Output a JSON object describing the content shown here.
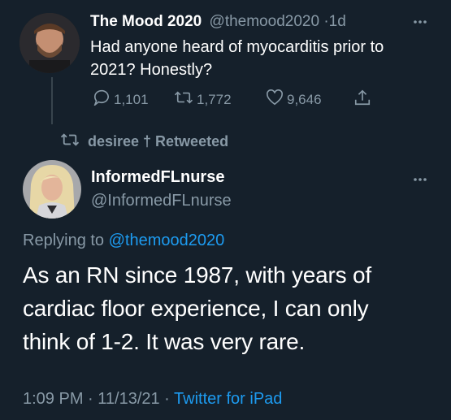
{
  "quoted_tweet": {
    "display_name": "The Mood 2020",
    "handle": "@themood2020",
    "separator": "·",
    "time_ago": "1d",
    "text_line1": "Had anyone heard of myocarditis prior to",
    "text_line2": "2021? Honestly?",
    "replies": "1,101",
    "retweets": "1,772",
    "likes": "9,646"
  },
  "retweet_banner": {
    "text": "desiree † Retweeted"
  },
  "main_tweet": {
    "display_name": "InformedFLnurse",
    "handle": "@InformedFLnurse",
    "replying_prefix": "Replying to",
    "replying_handle": "@themood2020",
    "text_line1": "As an RN since 1987, with years of",
    "text_line2": "cardiac floor experience, I can only",
    "text_line3": "think of 1-2. It was very rare.",
    "timestamp": "1:09 PM · 11/13/21 ·",
    "source": "Twitter for iPad"
  },
  "theme": {
    "background": "#15202b",
    "muted": "#8899a6",
    "link": "#1d9bf0"
  }
}
